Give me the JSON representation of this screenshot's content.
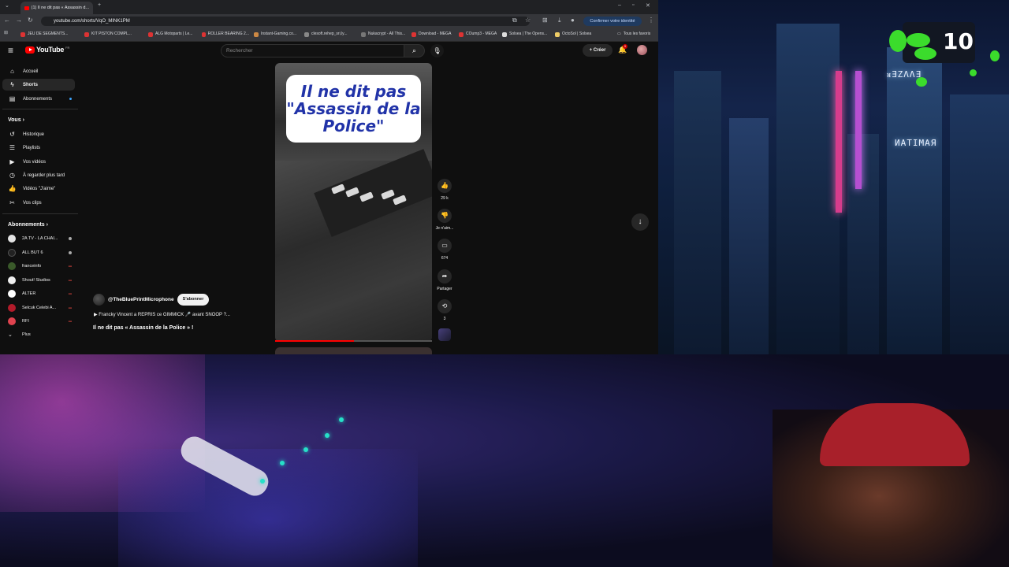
{
  "browser": {
    "tab_title": "(1) Il ne dit pas « Assassin d...",
    "url": "youtube.com/shorts/VqO_MINK1PM",
    "confirm_button": "Confirmer votre identité",
    "bookmarks": [
      "JEU DE SEGMENTS...",
      "KIT PISTON COMPL...",
      "ALG Motoparts | Le...",
      "ROLLER BEARING 2...",
      "Instant-Gaming.co...",
      "clesoft.rehep_sri,ly...",
      "Nukacrypt - All This...",
      "Download - MEGA",
      "COump3 - MEGA",
      "Solsea | The Opens...",
      "OctoSol | Solsea"
    ],
    "all_bookmarks": "Tous les favoris"
  },
  "youtube": {
    "logo": "YouTube",
    "country": "FR",
    "search_placeholder": "Rechercher",
    "create_label": "Créer",
    "bell_badge": "9",
    "sidebar": {
      "main": [
        {
          "label": "Accueil",
          "icon": "home-icon"
        },
        {
          "label": "Shorts",
          "icon": "shorts-icon"
        },
        {
          "label": "Abonnements",
          "icon": "subscriptions-icon"
        }
      ],
      "you_header": "Vous",
      "you": [
        {
          "label": "Historique",
          "icon": "history-icon"
        },
        {
          "label": "Playlists",
          "icon": "playlists-icon"
        },
        {
          "label": "Vos vidéos",
          "icon": "your-videos-icon"
        },
        {
          "label": "À regarder plus tard",
          "icon": "watch-later-icon"
        },
        {
          "label": "Vidéos \"J'aime\"",
          "icon": "liked-icon"
        },
        {
          "label": "Vos clips",
          "icon": "clips-icon"
        }
      ],
      "subs_header": "Abonnements",
      "subs": [
        {
          "name": "2A TV - LA CHAÎ...",
          "badge": "dot",
          "color": "#e4e4e4"
        },
        {
          "name": "ALL BUT 6",
          "badge": "dot",
          "color": "#222222"
        },
        {
          "name": "franceinfo",
          "badge": "live",
          "color": "#3a5a2a"
        },
        {
          "name": "Shout! Studios",
          "badge": "live",
          "color": "#f0f0f0"
        },
        {
          "name": "ALTER",
          "badge": "live",
          "color": "#ffffff"
        },
        {
          "name": "Selcuk Celebi A...",
          "badge": "live",
          "color": "#b21b2a"
        },
        {
          "name": "RFI",
          "badge": "live",
          "color": "#e0434f"
        }
      ],
      "more_label": "Plus"
    },
    "short": {
      "overlay_text": "Il ne dit pas \"Assassin de la Police\"",
      "channel": "@TheBluePrintMicrophone",
      "subscribe": "S'abonner",
      "music": "▶ Francky Vincent a REPRIS ce GIMMICK 🎤 avant SNOOP ?...",
      "title": "Il ne dit pas « Assassin de la Police » !",
      "progress": 0.5,
      "likes": "29 k",
      "dislike_label": "Je n'aim...",
      "comments": "674",
      "share_label": "Partager",
      "remix_count": "3"
    }
  },
  "stream": {
    "hud_number": "10",
    "neon_signs": [
      "ᴚƎZΛΛƎ",
      "ИАТIMAЯ"
    ]
  }
}
